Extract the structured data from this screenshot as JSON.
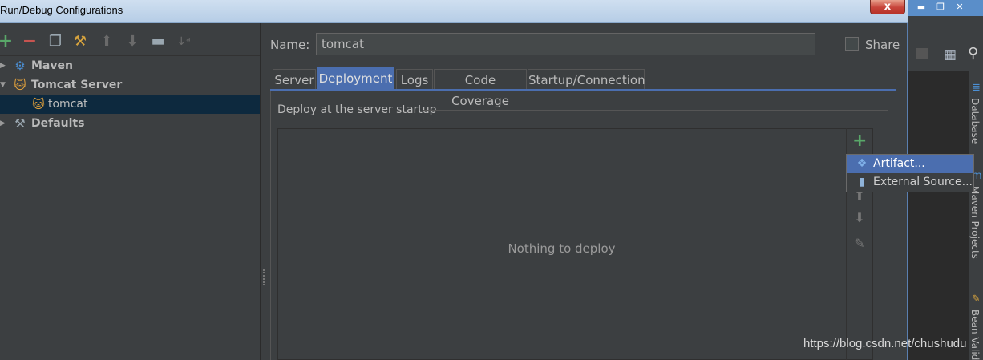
{
  "dialog": {
    "title": "Run/Debug Configurations",
    "close_label": "x"
  },
  "toolbar": {
    "icons": [
      "add-icon",
      "remove-icon",
      "copy-icon",
      "wrench-icon",
      "move-up-icon",
      "move-down-icon",
      "folder-icon",
      "sort-icon"
    ]
  },
  "tree": {
    "items": [
      {
        "label": "Maven",
        "icon": "gear-icon",
        "expanded": false
      },
      {
        "label": "Tomcat Server",
        "icon": "tomcat-icon",
        "expanded": true
      },
      {
        "label": "tomcat",
        "icon": "tomcat-icon",
        "selected": true
      },
      {
        "label": "Defaults",
        "icon": "wrench-icon",
        "expanded": false
      }
    ]
  },
  "form": {
    "name_label": "Name:",
    "name_value": "tomcat",
    "share_label": "Share",
    "share_checked": false
  },
  "tabs": [
    {
      "label": "Server"
    },
    {
      "label": "Deployment",
      "active": true
    },
    {
      "label": "Logs"
    },
    {
      "label": "Code Coverage"
    },
    {
      "label": "Startup/Connection"
    }
  ],
  "deployment": {
    "section_title": "Deploy at the server startup",
    "empty_text": "Nothing to deploy"
  },
  "popup": {
    "items": [
      {
        "label": "Artifact...",
        "icon": "artifact-icon",
        "highlighted": true
      },
      {
        "label": "External Source...",
        "icon": "jar-icon",
        "highlighted": false
      }
    ]
  },
  "ide_side_tabs": [
    "Database",
    "Maven Projects",
    "Bean Valid"
  ],
  "watermark": "https://blog.csdn.net/chushudu",
  "colors": {
    "accent": "#4b6eaf",
    "selection": "#0d293e",
    "add_green": "#59a869",
    "remove_red": "#c75450"
  }
}
